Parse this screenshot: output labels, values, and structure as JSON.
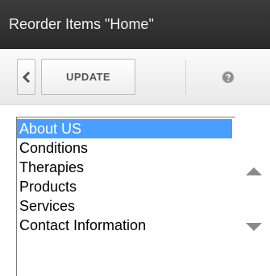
{
  "window": {
    "title": "Reorder Items \"Home\""
  },
  "toolbar": {
    "back_icon": "chevron-left-icon",
    "update_label": "UPDATE",
    "help_icon": "help-icon"
  },
  "list": {
    "items": [
      {
        "label": "About US",
        "selected": true
      },
      {
        "label": "Conditions",
        "selected": false
      },
      {
        "label": "Therapies",
        "selected": false
      },
      {
        "label": "Products",
        "selected": false
      },
      {
        "label": "Services",
        "selected": false
      },
      {
        "label": "Contact Information",
        "selected": false
      }
    ]
  },
  "controls": {
    "move_up_icon": "triangle-up-icon",
    "move_down_icon": "triangle-down-icon"
  },
  "colors": {
    "titlebar_bg": "#333333",
    "titlebar_text": "#f2f2f2",
    "selection_bg": "#4a9eff",
    "selection_text": "#ffffff",
    "arrow_gray": "#8a8a8a"
  }
}
